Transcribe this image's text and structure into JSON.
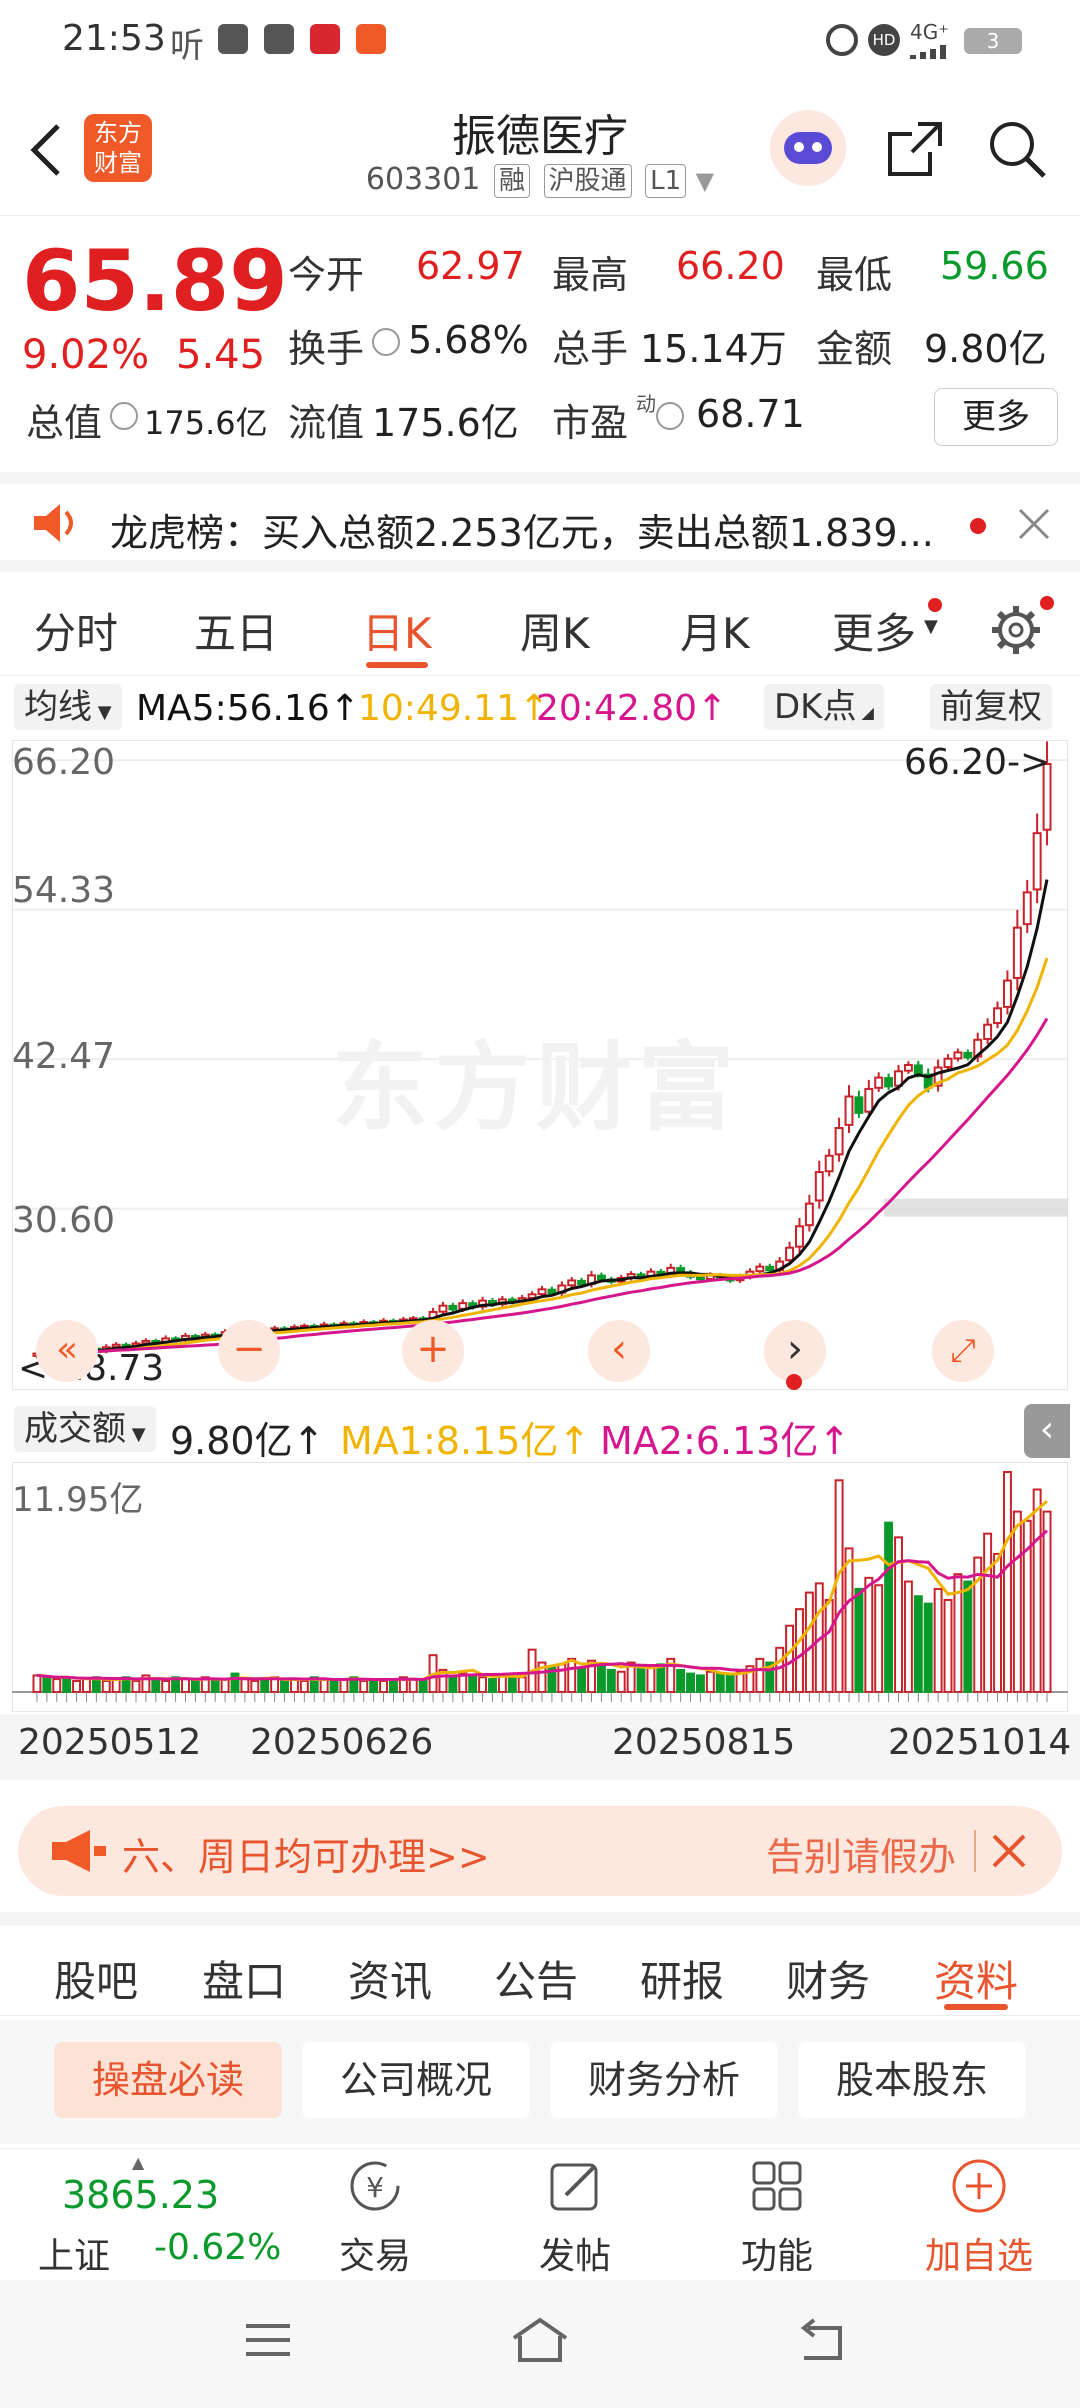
{
  "status_bar": {
    "time": "21:53",
    "listen": "听",
    "network": "4G⁺",
    "battery": "3"
  },
  "header": {
    "back_label": "返回",
    "app_logo_top": "东方",
    "app_logo_bottom": "财富",
    "title": "振德医疗",
    "code": "603301",
    "tags": [
      "融",
      "沪股通",
      "L1"
    ]
  },
  "quote": {
    "price": "65.89",
    "change_pct": "9.02%",
    "change_amt": "5.45",
    "open_label": "今开",
    "open": "62.97",
    "high_label": "最高",
    "high": "66.20",
    "low_label": "最低",
    "low": "59.66",
    "turnover_label": "换手",
    "turnover": "5.68%",
    "volume_label": "总手",
    "volume": "15.14万",
    "amount_label": "金额",
    "amount": "9.80亿",
    "mktcap_label": "总值",
    "mktcap": "175.6亿",
    "float_label": "流值",
    "float": "175.6亿",
    "pe_label": "市盈",
    "pe_sup": "动",
    "pe": "68.71",
    "more_label": "更多"
  },
  "notice": {
    "text": "龙虎榜：买入总额2.253亿元，卖出总额1.839..."
  },
  "ktabs": [
    {
      "label": "分时"
    },
    {
      "label": "五日"
    },
    {
      "label": "日K"
    },
    {
      "label": "周K"
    },
    {
      "label": "月K"
    },
    {
      "label": "更多"
    }
  ],
  "ma": {
    "selector": "均线",
    "ma5": "MA5:56.16↑",
    "ma10": "10:49.11↑",
    "ma20": "20:42.80↑",
    "dk": "DK点",
    "fq": "前复权"
  },
  "colors": {
    "ma5": "#111111",
    "ma10": "#f0b400",
    "ma20": "#d6168c",
    "up": "#c8222a",
    "down": "#0a9a2c",
    "accent": "#e8542e"
  },
  "chart_data": {
    "type": "candlestick",
    "y_ticks": [
      "66.20",
      "54.33",
      "42.47",
      "30.60"
    ],
    "ylim": [
      17.0,
      67.0
    ],
    "max_label": "66.20->",
    "min_label": "<-18.73",
    "closes": [
      19.1,
      19.0,
      19.3,
      19.2,
      19.4,
      19.5,
      19.3,
      19.6,
      19.8,
      19.7,
      19.9,
      20.1,
      20.0,
      20.3,
      20.2,
      20.5,
      20.4,
      20.6,
      20.5,
      20.8,
      20.7,
      20.9,
      21.0,
      20.9,
      21.1,
      21.0,
      21.2,
      21.3,
      21.2,
      21.4,
      21.3,
      21.5,
      21.4,
      21.6,
      21.5,
      21.7,
      21.6,
      21.8,
      21.9,
      21.8,
      22.4,
      22.9,
      22.6,
      23.1,
      22.8,
      23.3,
      23.0,
      23.4,
      23.2,
      23.5,
      23.8,
      24.2,
      23.9,
      24.5,
      24.9,
      24.6,
      25.3,
      25.0,
      24.8,
      25.1,
      25.4,
      25.2,
      25.6,
      25.3,
      25.9,
      25.5,
      25.2,
      25.0,
      25.3,
      25.1,
      24.9,
      25.2,
      25.6,
      26.0,
      25.7,
      26.4,
      27.5,
      29.2,
      31.0,
      33.5,
      34.8,
      37.0,
      39.5,
      38.2,
      40.1,
      41.0,
      40.3,
      41.5,
      42.0,
      41.3,
      40.2,
      41.8,
      42.5,
      43.0,
      42.6,
      44.0,
      45.2,
      46.5,
      48.7,
      52.9,
      55.7,
      60.4,
      65.89
    ],
    "vol_label": "11.95亿",
    "vol_ma1": "MA1:8.15亿↑",
    "vol_ma2": "MA2:6.13亿↑",
    "vol_value": "9.80亿↑",
    "vol_selector": "成交额",
    "volumes": [
      0.9,
      0.8,
      0.7,
      0.8,
      0.6,
      0.7,
      0.8,
      0.6,
      0.7,
      0.8,
      0.6,
      0.9,
      0.7,
      0.6,
      0.8,
      0.7,
      0.6,
      0.8,
      0.6,
      0.7,
      1.0,
      0.7,
      0.6,
      0.7,
      0.8,
      0.6,
      0.7,
      0.6,
      0.8,
      0.7,
      0.6,
      0.7,
      0.8,
      0.6,
      0.7,
      0.6,
      0.7,
      0.8,
      0.7,
      0.6,
      2.0,
      1.2,
      0.8,
      1.0,
      0.9,
      0.8,
      0.7,
      0.9,
      1.0,
      0.8,
      2.3,
      1.6,
      1.4,
      1.5,
      1.8,
      1.3,
      1.7,
      1.5,
      1.2,
      1.1,
      1.6,
      1.4,
      1.3,
      1.5,
      1.8,
      1.2,
      1.0,
      0.9,
      1.1,
      1.0,
      0.9,
      1.1,
      1.4,
      1.8,
      1.6,
      2.4,
      3.6,
      4.5,
      5.4,
      5.9,
      5.0,
      11.5,
      7.8,
      5.6,
      6.2,
      5.8,
      9.2,
      8.4,
      6.0,
      5.2,
      4.8,
      5.6,
      5.0,
      6.4,
      6.0,
      7.3,
      8.6,
      7.5,
      11.95,
      9.8,
      9.3,
      11.0,
      9.8
    ],
    "x_ticks": [
      "20250512",
      "20250626",
      "20250815",
      "20251014"
    ]
  },
  "banner": {
    "text": "六、周日均可办理>>",
    "right": "告别请假办"
  },
  "sectabs": [
    {
      "label": "股吧"
    },
    {
      "label": "盘口"
    },
    {
      "label": "资讯"
    },
    {
      "label": "公告"
    },
    {
      "label": "研报"
    },
    {
      "label": "财务"
    },
    {
      "label": "资料"
    }
  ],
  "subtabs": [
    {
      "label": "操盘必读"
    },
    {
      "label": "公司概况"
    },
    {
      "label": "财务分析"
    },
    {
      "label": "股本股东"
    }
  ],
  "bottom": {
    "index_value": "3865.23",
    "index_name": "上证",
    "index_change": "-0.62%",
    "trade": "交易",
    "post": "发帖",
    "func": "功能",
    "add": "加自选"
  },
  "watermark": "东方财富"
}
